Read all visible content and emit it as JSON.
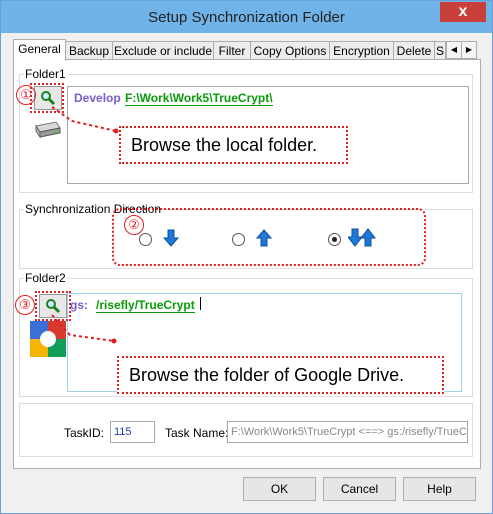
{
  "window": {
    "title": "Setup Synchronization Folder",
    "close_glyph": "x"
  },
  "tabs": [
    "General",
    "Backup",
    "Exclude or include",
    "Filter",
    "Copy Options",
    "Encryption",
    "Delete",
    "S"
  ],
  "folder1": {
    "label": "Folder1",
    "prefix": "Develop",
    "path": "F:\\Work\\Work5\\TrueCrypt\\",
    "callout": "Browse the local folder.",
    "marker": "①",
    "icons": [
      "magnifier-icon",
      "hard-drive-icon"
    ]
  },
  "direction": {
    "label": "Synchronization Direction",
    "marker": "②",
    "options": [
      "down",
      "up",
      "both"
    ],
    "selected": "both"
  },
  "folder2": {
    "label": "Folder2",
    "prefix": "gs:",
    "path": "/risefly/TrueCrypt",
    "callout": "Browse the folder of Google Drive.",
    "marker": "③",
    "icons": [
      "magnifier-icon",
      "google-drive-icon"
    ]
  },
  "task": {
    "id_label": "TaskID:",
    "id_value": "115",
    "name_label": "Task Name:",
    "name_value": "F:\\Work\\Work5\\TrueCrypt <==> gs:/risefly/TrueC"
  },
  "buttons": {
    "ok": "OK",
    "cancel": "Cancel",
    "help": "Help"
  },
  "colors": {
    "titlebar": "#6fb3e8",
    "close": "#c7403a",
    "annotation": "#e02020",
    "path_green": "#0a9a0a",
    "prefix_purple": "#7a5cc8",
    "arrow_blue": "#1e78d8"
  }
}
